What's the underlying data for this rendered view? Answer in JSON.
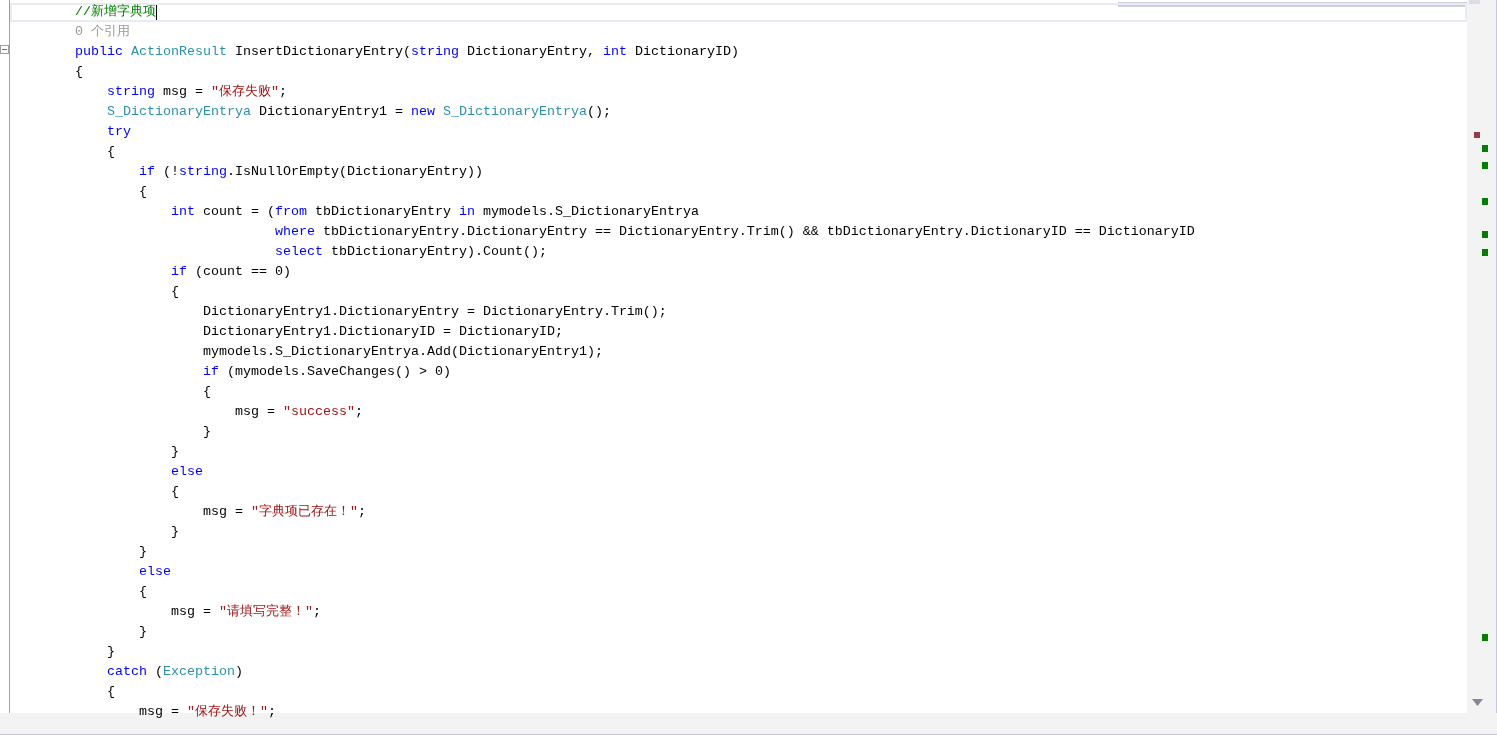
{
  "editor": {
    "lines": [
      {
        "tokens": [
          {
            "kind": "comment",
            "text": "//新增字典项"
          }
        ],
        "caret": true
      },
      {
        "tokens": [
          {
            "kind": "codelens",
            "text": "0 个引用"
          }
        ]
      },
      {
        "tokens": [
          {
            "kind": "keyword",
            "text": "public "
          },
          {
            "kind": "type",
            "text": "ActionResult"
          },
          {
            "kind": "plain",
            "text": " InsertDictionaryEntry("
          },
          {
            "kind": "keyword",
            "text": "string"
          },
          {
            "kind": "plain",
            "text": " DictionaryEntry, "
          },
          {
            "kind": "keyword",
            "text": "int"
          },
          {
            "kind": "plain",
            "text": " DictionaryID)"
          }
        ]
      },
      {
        "tokens": [
          {
            "kind": "plain",
            "text": "{"
          }
        ]
      },
      {
        "tokens": [
          {
            "kind": "keyword",
            "text": "    string"
          },
          {
            "kind": "plain",
            "text": " msg = "
          },
          {
            "kind": "string",
            "text": "\"保存失败\""
          },
          {
            "kind": "plain",
            "text": ";"
          }
        ]
      },
      {
        "tokens": [
          {
            "kind": "type",
            "text": "    S_DictionaryEntrya"
          },
          {
            "kind": "plain",
            "text": " DictionaryEntry1 = "
          },
          {
            "kind": "keyword",
            "text": "new "
          },
          {
            "kind": "type",
            "text": "S_DictionaryEntrya"
          },
          {
            "kind": "plain",
            "text": "();"
          }
        ]
      },
      {
        "tokens": [
          {
            "kind": "keyword",
            "text": "    try"
          }
        ]
      },
      {
        "tokens": [
          {
            "kind": "plain",
            "text": "    {"
          }
        ]
      },
      {
        "tokens": [
          {
            "kind": "keyword",
            "text": "        if"
          },
          {
            "kind": "plain",
            "text": " (!"
          },
          {
            "kind": "keyword",
            "text": "string"
          },
          {
            "kind": "plain",
            "text": ".IsNullOrEmpty(DictionaryEntry))"
          }
        ]
      },
      {
        "tokens": [
          {
            "kind": "plain",
            "text": "        {"
          }
        ]
      },
      {
        "tokens": [
          {
            "kind": "keyword",
            "text": "            int"
          },
          {
            "kind": "plain",
            "text": " count = ("
          },
          {
            "kind": "keyword",
            "text": "from"
          },
          {
            "kind": "plain",
            "text": " tbDictionaryEntry "
          },
          {
            "kind": "keyword",
            "text": "in"
          },
          {
            "kind": "plain",
            "text": " mymodels.S_DictionaryEntrya"
          }
        ]
      },
      {
        "tokens": [
          {
            "kind": "keyword",
            "text": "                         where"
          },
          {
            "kind": "plain",
            "text": " tbDictionaryEntry.DictionaryEntry == DictionaryEntry.Trim() && tbDictionaryEntry.DictionaryID == DictionaryID"
          }
        ]
      },
      {
        "tokens": [
          {
            "kind": "keyword",
            "text": "                         select"
          },
          {
            "kind": "plain",
            "text": " tbDictionaryEntry).Count();"
          }
        ]
      },
      {
        "tokens": [
          {
            "kind": "keyword",
            "text": "            if"
          },
          {
            "kind": "plain",
            "text": " (count == 0)"
          }
        ]
      },
      {
        "tokens": [
          {
            "kind": "plain",
            "text": "            {"
          }
        ]
      },
      {
        "tokens": [
          {
            "kind": "plain",
            "text": "                DictionaryEntry1.DictionaryEntry = DictionaryEntry.Trim();"
          }
        ]
      },
      {
        "tokens": [
          {
            "kind": "plain",
            "text": "                DictionaryEntry1.DictionaryID = DictionaryID;"
          }
        ]
      },
      {
        "tokens": [
          {
            "kind": "plain",
            "text": "                mymodels.S_DictionaryEntrya.Add(DictionaryEntry1);"
          }
        ]
      },
      {
        "tokens": [
          {
            "kind": "keyword",
            "text": "                if"
          },
          {
            "kind": "plain",
            "text": " (mymodels.SaveChanges() > 0)"
          }
        ]
      },
      {
        "tokens": [
          {
            "kind": "plain",
            "text": "                {"
          }
        ]
      },
      {
        "tokens": [
          {
            "kind": "plain",
            "text": "                    msg = "
          },
          {
            "kind": "string",
            "text": "\"success\""
          },
          {
            "kind": "plain",
            "text": ";"
          }
        ]
      },
      {
        "tokens": [
          {
            "kind": "plain",
            "text": "                }"
          }
        ]
      },
      {
        "tokens": [
          {
            "kind": "plain",
            "text": "            }"
          }
        ]
      },
      {
        "tokens": [
          {
            "kind": "keyword",
            "text": "            else"
          }
        ]
      },
      {
        "tokens": [
          {
            "kind": "plain",
            "text": "            {"
          }
        ]
      },
      {
        "tokens": [
          {
            "kind": "plain",
            "text": "                msg = "
          },
          {
            "kind": "string",
            "text": "\"字典项已存在！\""
          },
          {
            "kind": "plain",
            "text": ";"
          }
        ]
      },
      {
        "tokens": [
          {
            "kind": "plain",
            "text": "            }"
          }
        ]
      },
      {
        "tokens": [
          {
            "kind": "plain",
            "text": "        }"
          }
        ]
      },
      {
        "tokens": [
          {
            "kind": "keyword",
            "text": "        else"
          }
        ]
      },
      {
        "tokens": [
          {
            "kind": "plain",
            "text": "        {"
          }
        ]
      },
      {
        "tokens": [
          {
            "kind": "plain",
            "text": "            msg = "
          },
          {
            "kind": "string",
            "text": "\"请填写完整！\""
          },
          {
            "kind": "plain",
            "text": ";"
          }
        ]
      },
      {
        "tokens": [
          {
            "kind": "plain",
            "text": "        }"
          }
        ]
      },
      {
        "tokens": [
          {
            "kind": "plain",
            "text": "    }"
          }
        ]
      },
      {
        "tokens": [
          {
            "kind": "keyword",
            "text": "    catch"
          },
          {
            "kind": "plain",
            "text": " ("
          },
          {
            "kind": "type",
            "text": "Exception"
          },
          {
            "kind": "plain",
            "text": ")"
          }
        ]
      },
      {
        "tokens": [
          {
            "kind": "plain",
            "text": "    {"
          }
        ]
      },
      {
        "tokens": [
          {
            "kind": "plain",
            "text": "        msg = "
          },
          {
            "kind": "string",
            "text": "\"保存失败！\""
          },
          {
            "kind": "plain",
            "text": ";"
          }
        ]
      }
    ]
  }
}
